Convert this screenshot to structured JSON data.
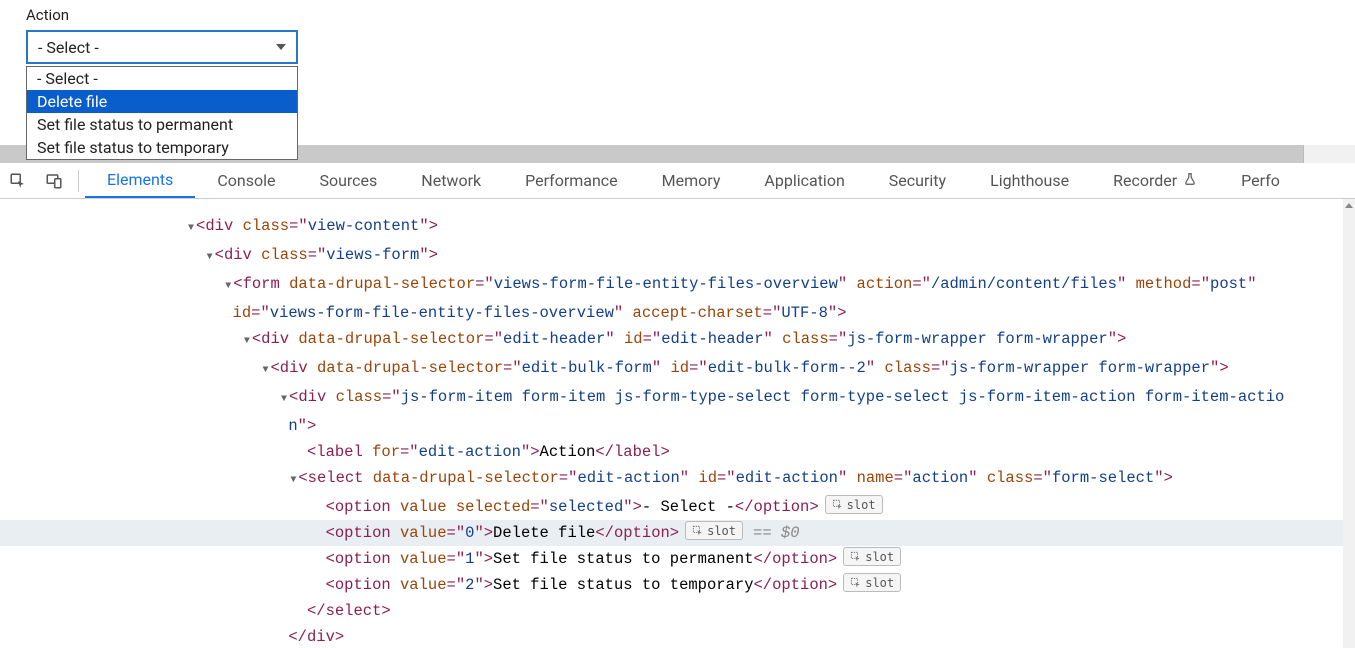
{
  "page": {
    "label": "Action",
    "select": {
      "value": "- Select -",
      "options": [
        "- Select -",
        "Delete file",
        "Set file status to permanent",
        "Set file status to temporary"
      ],
      "highlighted_index": 1
    }
  },
  "devtools": {
    "tabs": [
      "Elements",
      "Console",
      "Sources",
      "Network",
      "Performance",
      "Memory",
      "Application",
      "Security",
      "Lighthouse",
      "Recorder",
      "Perfo"
    ],
    "active_index": 0
  },
  "slot_label": "slot",
  "selected_marker": "== $0",
  "dom": {
    "l0": {
      "cls": "view-content"
    },
    "l1": {
      "cls": "views-form"
    },
    "l2": {
      "dds": "views-form-file-entity-files-overview",
      "action": "/admin/content/files",
      "method": "post",
      "id": "views-form-file-entity-files-overview",
      "ac": "UTF-8"
    },
    "l3": {
      "dds": "edit-header",
      "id": "edit-header",
      "cls": "js-form-wrapper form-wrapper"
    },
    "l4": {
      "dds": "edit-bulk-form",
      "id": "edit-bulk-form--2",
      "cls": "js-form-wrapper form-wrapper"
    },
    "l5": {
      "cls": "js-form-item form-item js-form-type-select form-type-select js-form-item-action form-item-actio",
      "cls_tail": "n"
    },
    "l6": {
      "for": "edit-action",
      "text": "Action"
    },
    "l7": {
      "dds": "edit-action",
      "id": "edit-action",
      "name": "action",
      "cls": "form-select"
    },
    "opt0": {
      "sel": "selected",
      "text": "- Select -"
    },
    "opt1": {
      "val": "0",
      "text": "Delete file"
    },
    "opt2": {
      "val": "1",
      "text": "Set file status to permanent"
    },
    "opt3": {
      "val": "2",
      "text": "Set file status to temporary"
    }
  }
}
